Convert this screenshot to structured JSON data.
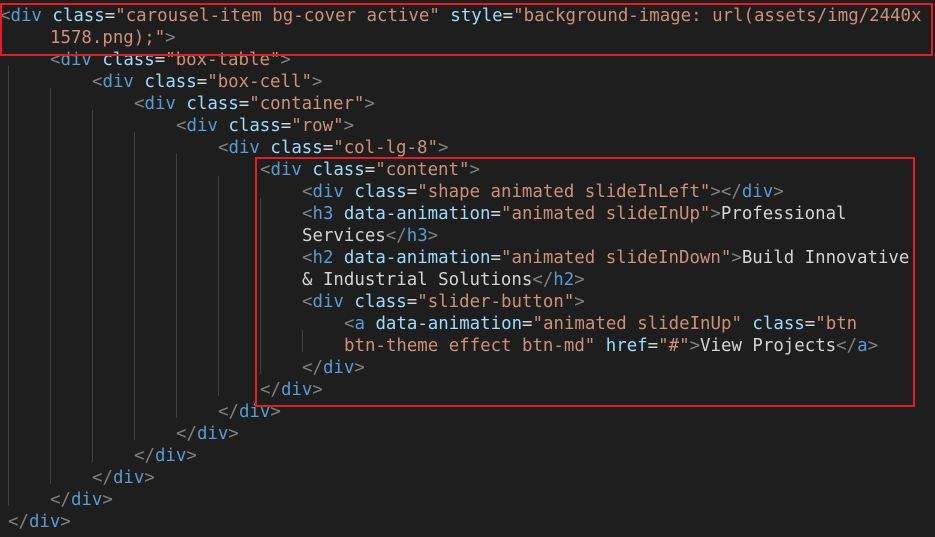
{
  "editor": {
    "lines": [
      [
        [
          "punc",
          "<"
        ],
        [
          "tag",
          "div"
        ],
        [
          "text",
          " "
        ],
        [
          "attr",
          "class"
        ],
        [
          "text",
          "="
        ],
        [
          "str",
          "\"carousel-item bg-cover active\""
        ],
        [
          "text",
          " "
        ],
        [
          "attr",
          "style"
        ],
        [
          "text",
          "="
        ],
        [
          "str",
          "\"background-image: "
        ],
        [
          "url",
          "url(assets/img/2440x"
        ]
      ],
      [
        [
          "str",
          "1578.png);\""
        ],
        [
          "punc",
          ">"
        ]
      ],
      [
        [
          "punc",
          "<"
        ],
        [
          "tag",
          "div"
        ],
        [
          "text",
          " "
        ],
        [
          "attr",
          "class"
        ],
        [
          "text",
          "="
        ],
        [
          "str",
          "\"box-table\""
        ],
        [
          "punc",
          ">"
        ]
      ],
      [
        [
          "punc",
          "<"
        ],
        [
          "tag",
          "div"
        ],
        [
          "text",
          " "
        ],
        [
          "attr",
          "class"
        ],
        [
          "text",
          "="
        ],
        [
          "str",
          "\"box-cell\""
        ],
        [
          "punc",
          ">"
        ]
      ],
      [
        [
          "punc",
          "<"
        ],
        [
          "tag",
          "div"
        ],
        [
          "text",
          " "
        ],
        [
          "attr",
          "class"
        ],
        [
          "text",
          "="
        ],
        [
          "str",
          "\"container\""
        ],
        [
          "punc",
          ">"
        ]
      ],
      [
        [
          "punc",
          "<"
        ],
        [
          "tag",
          "div"
        ],
        [
          "text",
          " "
        ],
        [
          "attr",
          "class"
        ],
        [
          "text",
          "="
        ],
        [
          "str",
          "\"row\""
        ],
        [
          "punc",
          ">"
        ]
      ],
      [
        [
          "punc",
          "<"
        ],
        [
          "tag",
          "div"
        ],
        [
          "text",
          " "
        ],
        [
          "attr",
          "class"
        ],
        [
          "text",
          "="
        ],
        [
          "str",
          "\"col-lg-8\""
        ],
        [
          "punc",
          ">"
        ]
      ],
      [
        [
          "punc",
          "<"
        ],
        [
          "tag",
          "div"
        ],
        [
          "text",
          " "
        ],
        [
          "attr",
          "class"
        ],
        [
          "text",
          "="
        ],
        [
          "str",
          "\"content\""
        ],
        [
          "punc",
          ">"
        ]
      ],
      [
        [
          "punc",
          "<"
        ],
        [
          "tag",
          "div"
        ],
        [
          "text",
          " "
        ],
        [
          "attr",
          "class"
        ],
        [
          "text",
          "="
        ],
        [
          "str",
          "\"shape animated slideInLeft\""
        ],
        [
          "punc",
          "></"
        ],
        [
          "tag",
          "div"
        ],
        [
          "punc",
          ">"
        ]
      ],
      [
        [
          "punc",
          "<"
        ],
        [
          "tag",
          "h3"
        ],
        [
          "text",
          " "
        ],
        [
          "attr",
          "data-animation"
        ],
        [
          "text",
          "="
        ],
        [
          "str",
          "\"animated slideInUp\""
        ],
        [
          "punc",
          ">"
        ],
        [
          "text",
          "Professional"
        ]
      ],
      [
        [
          "text",
          "Services"
        ],
        [
          "punc",
          "</"
        ],
        [
          "tag",
          "h3"
        ],
        [
          "punc",
          ">"
        ]
      ],
      [
        [
          "punc",
          "<"
        ],
        [
          "tag",
          "h2"
        ],
        [
          "text",
          " "
        ],
        [
          "attr",
          "data-animation"
        ],
        [
          "text",
          "="
        ],
        [
          "str",
          "\"animated slideInDown\""
        ],
        [
          "punc",
          ">"
        ],
        [
          "text",
          "Build Innovative"
        ]
      ],
      [
        [
          "text",
          "& Industrial Solutions"
        ],
        [
          "punc",
          "</"
        ],
        [
          "tag",
          "h2"
        ],
        [
          "punc",
          ">"
        ]
      ],
      [
        [
          "punc",
          "<"
        ],
        [
          "tag",
          "div"
        ],
        [
          "text",
          " "
        ],
        [
          "attr",
          "class"
        ],
        [
          "text",
          "="
        ],
        [
          "str",
          "\"slider-button\""
        ],
        [
          "punc",
          ">"
        ]
      ],
      [
        [
          "punc",
          "<"
        ],
        [
          "tag",
          "a"
        ],
        [
          "text",
          " "
        ],
        [
          "attr",
          "data-animation"
        ],
        [
          "text",
          "="
        ],
        [
          "str",
          "\"animated slideInUp\""
        ],
        [
          "text",
          " "
        ],
        [
          "attr",
          "class"
        ],
        [
          "text",
          "="
        ],
        [
          "str",
          "\"btn"
        ]
      ],
      [
        [
          "str",
          "btn-theme effect btn-md\""
        ],
        [
          "text",
          " "
        ],
        [
          "attr",
          "href"
        ],
        [
          "text",
          "="
        ],
        [
          "str",
          "\"#\""
        ],
        [
          "punc",
          ">"
        ],
        [
          "text",
          "View Projects"
        ],
        [
          "punc",
          "</"
        ],
        [
          "tag",
          "a"
        ],
        [
          "punc",
          ">"
        ]
      ],
      [
        [
          "punc",
          "</"
        ],
        [
          "tag",
          "div"
        ],
        [
          "punc",
          ">"
        ]
      ],
      [
        [
          "punc",
          "</"
        ],
        [
          "tag",
          "div"
        ],
        [
          "punc",
          ">"
        ]
      ],
      [
        [
          "punc",
          "</"
        ],
        [
          "tag",
          "div"
        ],
        [
          "punc",
          ">"
        ]
      ],
      [
        [
          "punc",
          "</"
        ],
        [
          "tag",
          "div"
        ],
        [
          "punc",
          ">"
        ]
      ],
      [
        [
          "punc",
          "</"
        ],
        [
          "tag",
          "div"
        ],
        [
          "punc",
          ">"
        ]
      ],
      [
        [
          "punc",
          "</"
        ],
        [
          "tag",
          "div"
        ],
        [
          "punc",
          ">"
        ]
      ],
      [
        [
          "punc",
          "</"
        ],
        [
          "tag",
          "div"
        ],
        [
          "punc",
          ">"
        ]
      ],
      [
        [
          "punc",
          "</"
        ],
        [
          "tag",
          "div"
        ],
        [
          "punc",
          ">"
        ]
      ]
    ]
  },
  "colors": {
    "background": "#1e1e1e",
    "punctuation": "#808080",
    "tag": "#569cd6",
    "attribute": "#9cdcfe",
    "string": "#ce9178",
    "text": "#d4d4d4",
    "highlight_border": "#e51c23",
    "indent_guide": "#404040"
  }
}
